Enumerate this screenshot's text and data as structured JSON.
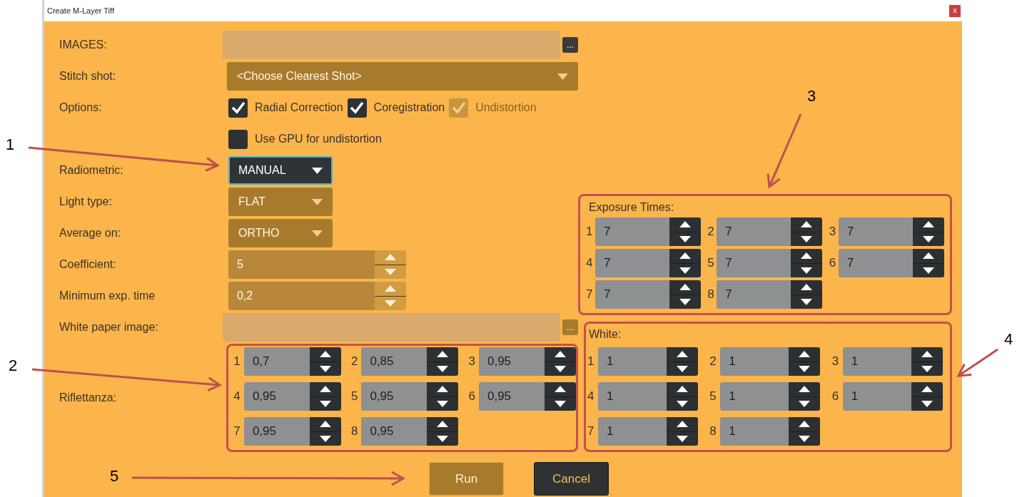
{
  "window": {
    "title": "Create M-Layer Tiff",
    "close": "x"
  },
  "rows": [
    {
      "label": "IMAGES:",
      "kind": "file",
      "button": "...",
      "browse_disabled": false
    },
    {
      "label": "Stitch shot:",
      "kind": "select",
      "placeholder": "<Choose Clearest Shot>",
      "disabled": true,
      "focused": false
    },
    {
      "label": "Options:",
      "kind": "checks",
      "items": [
        {
          "label": "Radial Correction",
          "checked": true,
          "disabled": false
        },
        {
          "label": "Coregistration",
          "checked": true,
          "disabled": false
        },
        {
          "label": "Undistortion",
          "checked": true,
          "disabled": true
        }
      ]
    },
    {
      "kind": "checks",
      "items": [
        {
          "label": "Use GPU for undistortion",
          "checked": false,
          "disabled": false
        }
      ]
    },
    {
      "label": "Radiometric:",
      "kind": "dropdown",
      "value": "MANUAL",
      "disabled": false,
      "focused": true
    },
    {
      "label": "Light type:",
      "kind": "dropdown",
      "value": "FLAT",
      "disabled": true,
      "focused": false
    },
    {
      "label": "Average on:",
      "kind": "dropdown",
      "value": "ORTHO",
      "disabled": true,
      "focused": false
    },
    {
      "label": "Coefficient:",
      "kind": "spinner",
      "value": "5",
      "disabled": true
    },
    {
      "label": "Minimum exp. time",
      "kind": "spinner",
      "value": "0,2",
      "disabled": true
    },
    {
      "label": "White paper image:",
      "kind": "file",
      "button": "...",
      "browse_disabled": true
    }
  ],
  "riflettanza": {
    "label": "Riflettanza:",
    "fields": [
      {
        "index": "1",
        "value": "0,7"
      },
      {
        "index": "2",
        "value": "0,85"
      },
      {
        "index": "3",
        "value": "0,95"
      },
      {
        "index": "4",
        "value": "0,95"
      },
      {
        "index": "5",
        "value": "0,95"
      },
      {
        "index": "6",
        "value": "0,95"
      },
      {
        "index": "7",
        "value": "0,95"
      },
      {
        "index": "8",
        "value": "0,95"
      }
    ]
  },
  "exposure_times": {
    "title": "Exposure Times:",
    "fields": [
      {
        "index": "1",
        "value": "7"
      },
      {
        "index": "2",
        "value": "7"
      },
      {
        "index": "3",
        "value": "7"
      },
      {
        "index": "4",
        "value": "7"
      },
      {
        "index": "5",
        "value": "7"
      },
      {
        "index": "6",
        "value": "7"
      },
      {
        "index": "7",
        "value": "7"
      },
      {
        "index": "8",
        "value": "7"
      }
    ]
  },
  "white": {
    "title": "White:",
    "fields": [
      {
        "index": "1",
        "value": "1"
      },
      {
        "index": "2",
        "value": "1"
      },
      {
        "index": "3",
        "value": "1"
      },
      {
        "index": "4",
        "value": "1"
      },
      {
        "index": "5",
        "value": "1"
      },
      {
        "index": "6",
        "value": "1"
      },
      {
        "index": "7",
        "value": "1"
      },
      {
        "index": "8",
        "value": "1"
      }
    ]
  },
  "buttons": [
    {
      "label": "Run",
      "disabled": true
    },
    {
      "label": "Cancel",
      "disabled": false
    }
  ],
  "callouts": [
    {
      "label": "1"
    },
    {
      "label": "2"
    },
    {
      "label": "3"
    },
    {
      "label": "4"
    },
    {
      "label": "5"
    }
  ]
}
